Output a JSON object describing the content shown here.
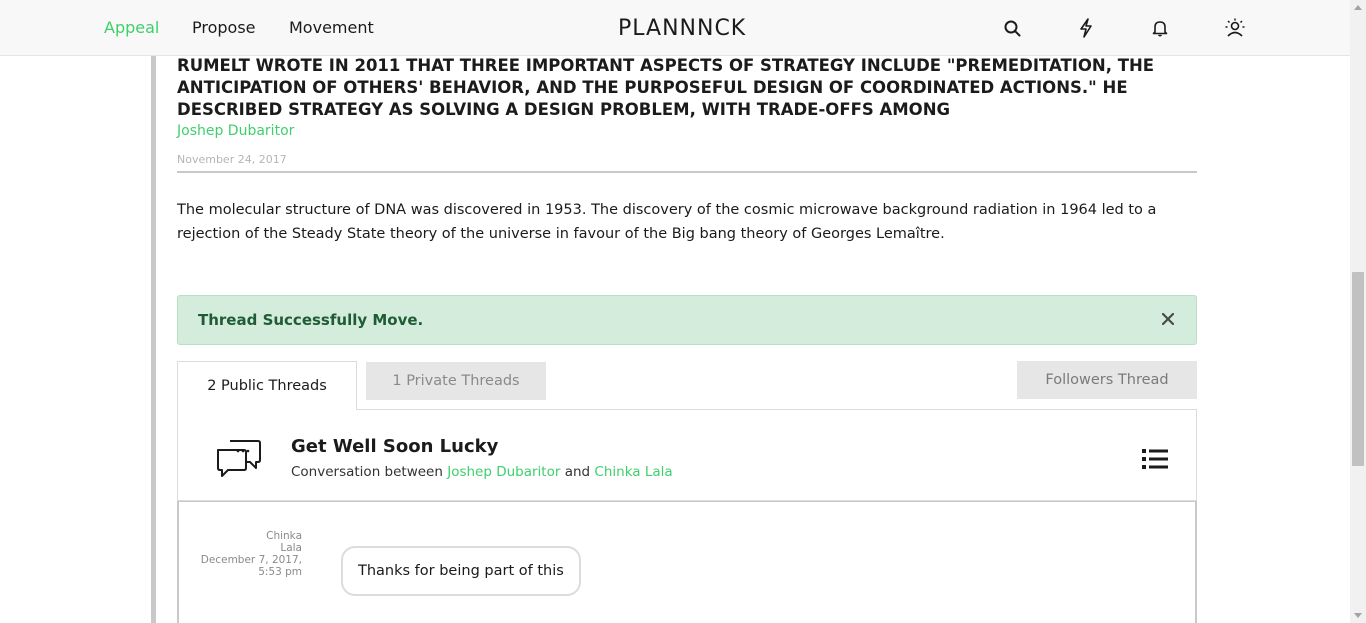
{
  "nav": {
    "links": [
      "Appeal",
      "Propose",
      "Movement"
    ],
    "active_link": "Appeal",
    "logo": "PLANNNCK",
    "icons": [
      "search-icon",
      "lightning-icon",
      "bell-icon",
      "user-sun-icon"
    ]
  },
  "article": {
    "headline": "RUMELT WROTE IN 2011 THAT THREE IMPORTANT ASPECTS OF STRATEGY INCLUDE \"PREMEDITATION, THE ANTICIPATION OF OTHERS' BEHAVIOR, AND THE PURPOSEFUL DESIGN OF COORDINATED ACTIONS.\" HE DESCRIBED STRATEGY AS SOLVING A DESIGN PROBLEM, WITH TRADE-OFFS AMONG",
    "author": "Joshep Dubaritor",
    "date": "November 24, 2017",
    "body": "The molecular structure of DNA was discovered in 1953. The discovery of the cosmic microwave background radiation in 1964 led to a rejection of the Steady State theory of the universe in favour of the Big bang theory of Georges Lemaître."
  },
  "alert": {
    "text": "Thread Successfully Move.",
    "close_icon": "close-icon"
  },
  "tabs": {
    "public": "2 Public Threads",
    "private": "1 Private Threads",
    "followers": "Followers Thread"
  },
  "thread": {
    "title": "Get Well Soon Lucky",
    "sub_prefix": "Conversation between",
    "participant_1": "Joshep Dubaritor",
    "sub_and": "and",
    "participant_2": "Chinka Lala"
  },
  "messages": [
    {
      "author_line1": "Chinka",
      "author_line2": "Lala",
      "date": "December 7, 2017,",
      "time": "5:53 pm",
      "text": "Thanks for being part of this"
    }
  ],
  "colors": {
    "accent": "#3fcf6d",
    "alert_bg": "#d4ecdc",
    "alert_text": "#1f5c35"
  }
}
